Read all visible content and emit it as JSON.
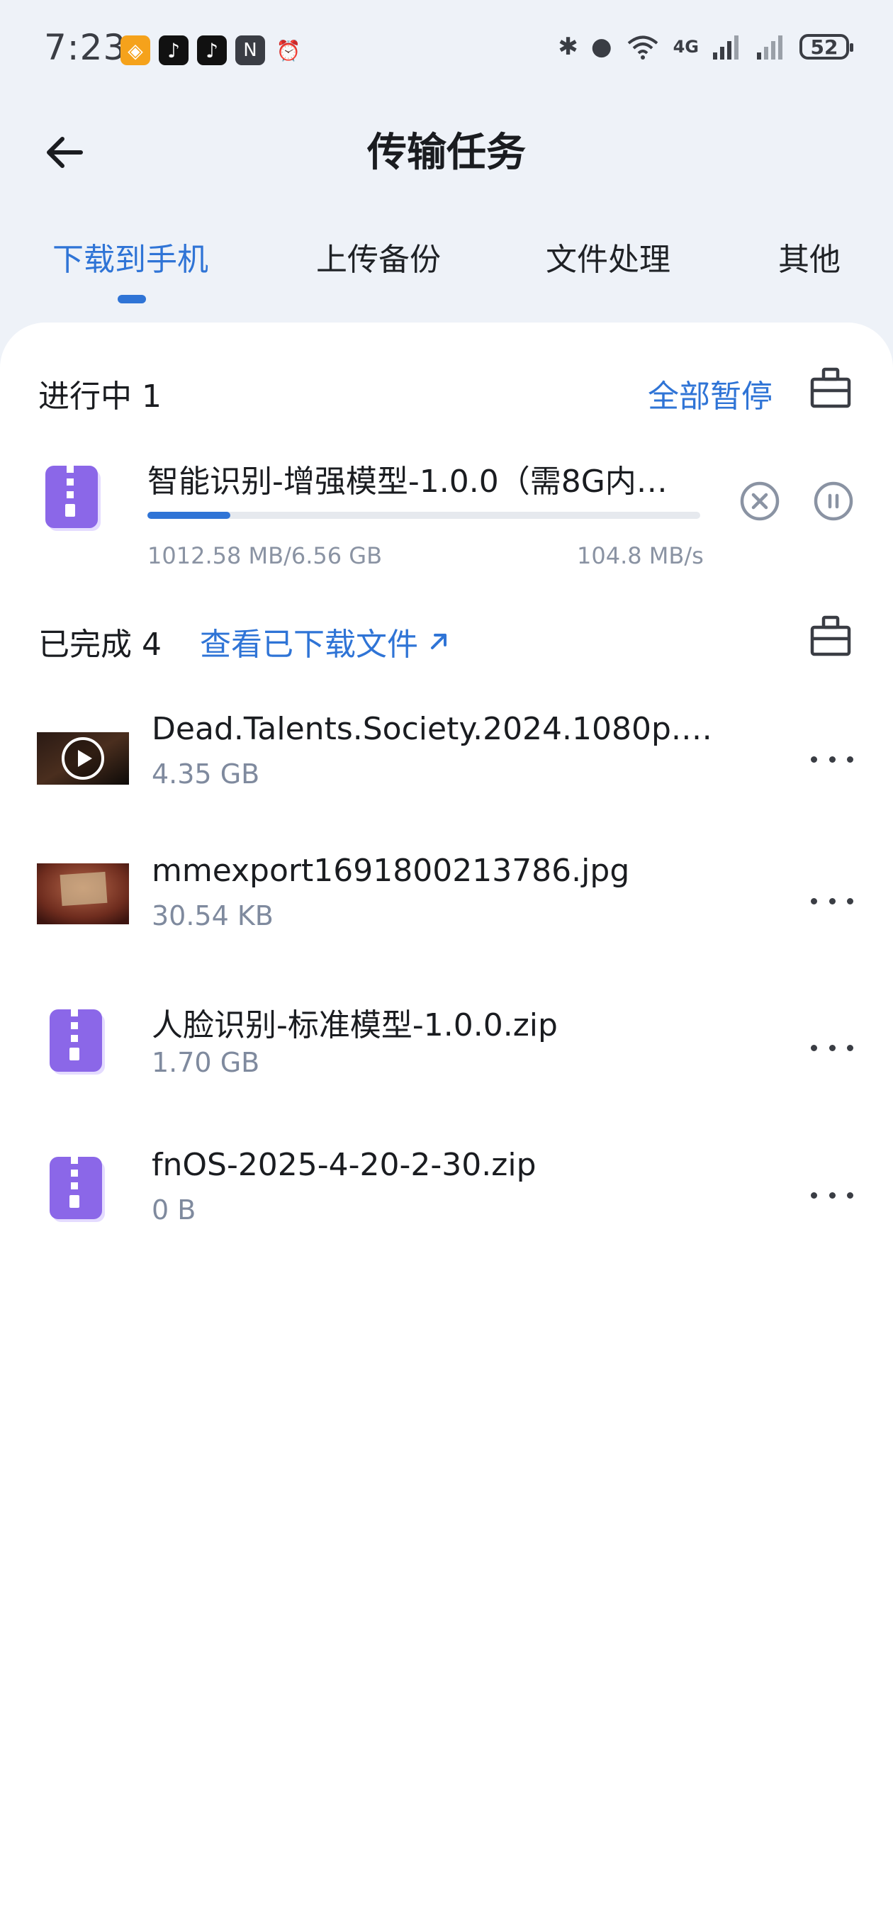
{
  "status_bar": {
    "time": "7:23",
    "battery": "52",
    "network": "4G",
    "icons": [
      "app-orange-icon",
      "tiktok-icon",
      "tiktok-lite-icon",
      "nfc-icon",
      "alarm-icon",
      "bluetooth-icon",
      "location-icon",
      "wifi-icon",
      "signal-icon",
      "signal-icon-2",
      "battery-icon"
    ]
  },
  "header": {
    "title": "传输任务",
    "back_icon": "arrow-left-icon"
  },
  "tabs": [
    {
      "label": "下载到手机",
      "active": true
    },
    {
      "label": "上传备份",
      "active": false
    },
    {
      "label": "文件处理",
      "active": false
    },
    {
      "label": "其他",
      "active": false
    }
  ],
  "in_progress": {
    "title": "进行中 1",
    "pause_all": "全部暂停",
    "clean_icon": "broom-icon",
    "items": [
      {
        "name": "智能识别-增强模型-1.0.0（需8G内…",
        "progress_text": "1012.58 MB/6.56 GB",
        "speed": "104.8 MB/s",
        "progress": 0.15,
        "icon": "zip-file-icon"
      }
    ]
  },
  "completed": {
    "title": "已完成 4",
    "view_link": "查看已下载文件",
    "view_link_icon": "external-arrow-icon",
    "clean_icon": "broom-icon",
    "items": [
      {
        "name": "Dead.Talents.Society.2024.1080p.N…",
        "size": "4.35 GB",
        "icon": "video-thumbnail"
      },
      {
        "name": "mmexport1691800213786.jpg",
        "size": "30.54 KB",
        "icon": "image-thumbnail"
      },
      {
        "name": "人脸识别-标准模型-1.0.0.zip",
        "size": "1.70 GB",
        "icon": "zip-file-icon"
      },
      {
        "name": "fnOS-2025-4-20-2-30.zip",
        "size": "0 B",
        "icon": "zip-file-icon"
      }
    ]
  },
  "colors": {
    "accent": "#2f74d6",
    "zip_purple": "#8b67e8",
    "page_bg": "#eef2f8"
  }
}
